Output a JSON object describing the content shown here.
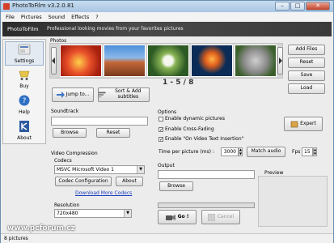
{
  "window": {
    "title": "PhotoToFilm v3.2.0.81"
  },
  "menu": [
    "File",
    "Pictures",
    "Sound",
    "Effects",
    "?"
  ],
  "banner": {
    "brand": "PhotoToFilm",
    "slogan": "Professional looking movies from your favorites pictures"
  },
  "sidebar": {
    "items": [
      {
        "label": "Settings",
        "icon": "gear-icon"
      },
      {
        "label": "Buy",
        "icon": "cart-icon"
      },
      {
        "label": "Help",
        "icon": "help-icon"
      },
      {
        "label": "About",
        "icon": "about-icon"
      }
    ]
  },
  "photos": {
    "label": "Photos",
    "buttons": {
      "add": "Add Files",
      "reset": "Reset",
      "save": "Save",
      "load": "Load"
    },
    "jump": "Jump to...",
    "sort": "Sort & Add subtitles",
    "counter": "1 - 5 / 8"
  },
  "soundtrack": {
    "label": "Soundtrack",
    "browse": "Browse",
    "reset": "Reset"
  },
  "options": {
    "label": "Options",
    "dynamic": "Enable dynamic pictures",
    "crossfade": "Enable Cross-Fading",
    "onvideo": "Enable \"On Video Text Insertion\"",
    "expert": "Expert",
    "time_label": "Time per picture (ms) :",
    "time_value": "3000",
    "match": "Match audio",
    "fps_label": "Fps :",
    "fps_value": "15"
  },
  "video": {
    "label": "Video Compression",
    "codecs_label": "Codecs",
    "codec": "MSVC Microsoft Video 1",
    "config": "Codec Configuration",
    "about": "About",
    "download": "Download More Codecs",
    "resolution_label": "Resolution",
    "resolution": "720x480"
  },
  "output": {
    "label": "Output",
    "browse": "Browse",
    "preview": "Preview",
    "go": "Go !",
    "cancel": "Cancel"
  },
  "status": "8 pictures",
  "watermark": "www.pcforum.cz"
}
